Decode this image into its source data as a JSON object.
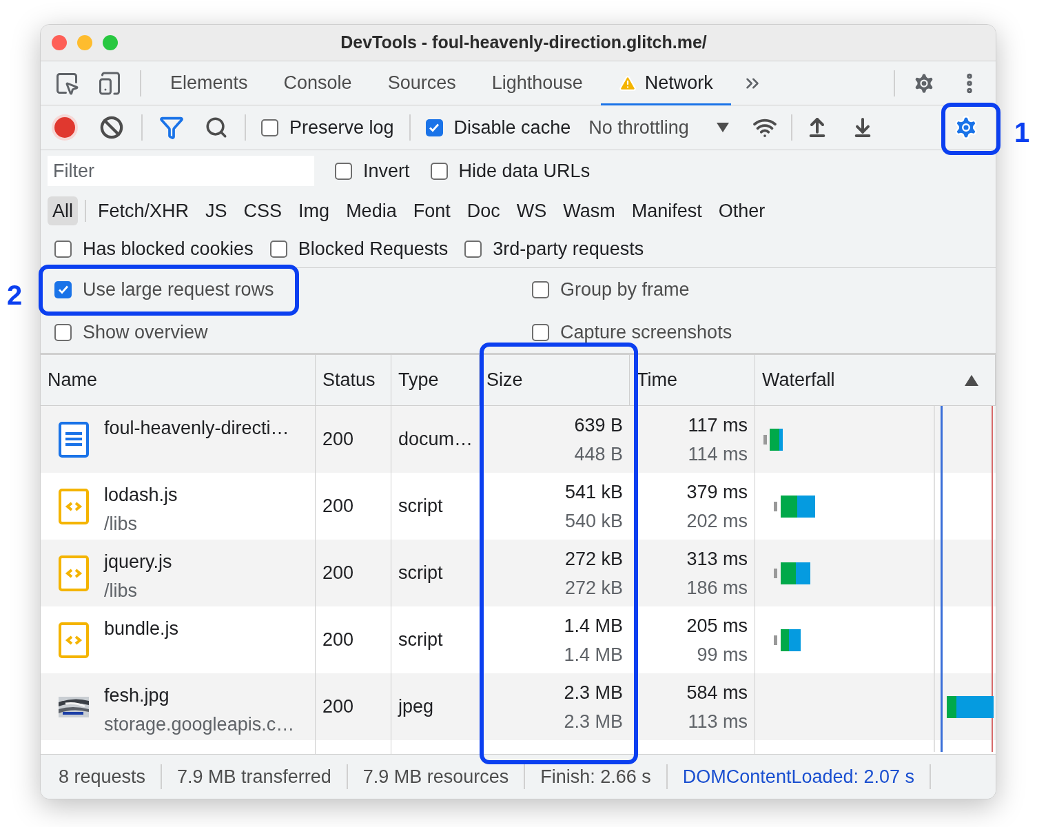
{
  "window": {
    "title": "DevTools - foul-heavenly-direction.glitch.me/"
  },
  "tabs": [
    {
      "label": "Elements",
      "kind": "plain",
      "selected": false
    },
    {
      "label": "Console",
      "kind": "plain",
      "selected": false
    },
    {
      "label": "Sources",
      "kind": "plain",
      "selected": false
    },
    {
      "label": "Lighthouse",
      "kind": "plain",
      "selected": false
    },
    {
      "label": "Network",
      "kind": "warning",
      "selected": true
    }
  ],
  "toolbar": {
    "preserve_log": {
      "label": "Preserve log",
      "checked": false
    },
    "disable_cache": {
      "label": "Disable cache",
      "checked": true
    },
    "throttling": {
      "value": "No throttling"
    }
  },
  "filter": {
    "placeholder": "Filter",
    "options": [
      {
        "label": "Invert",
        "checked": false
      },
      {
        "label": "Hide data URLs",
        "checked": false
      }
    ]
  },
  "type_filters": [
    {
      "label": "All",
      "selected": true
    },
    {
      "label": "Fetch/XHR",
      "selected": false
    },
    {
      "label": "JS",
      "selected": false
    },
    {
      "label": "CSS",
      "selected": false
    },
    {
      "label": "Img",
      "selected": false
    },
    {
      "label": "Media",
      "selected": false
    },
    {
      "label": "Font",
      "selected": false
    },
    {
      "label": "Doc",
      "selected": false
    },
    {
      "label": "WS",
      "selected": false
    },
    {
      "label": "Wasm",
      "selected": false
    },
    {
      "label": "Manifest",
      "selected": false
    },
    {
      "label": "Other",
      "selected": false
    }
  ],
  "request_filters": [
    {
      "label": "Has blocked cookies",
      "checked": false
    },
    {
      "label": "Blocked Requests",
      "checked": false
    },
    {
      "label": "3rd-party requests",
      "checked": false
    }
  ],
  "settings": [
    {
      "label": "Use large request rows",
      "checked": true
    },
    {
      "label": "Group by frame",
      "checked": false
    },
    {
      "label": "Show overview",
      "checked": false
    },
    {
      "label": "Capture screenshots",
      "checked": false
    }
  ],
  "table": {
    "columns": [
      {
        "label": "Name",
        "sorted": false
      },
      {
        "label": "Status",
        "sorted": false
      },
      {
        "label": "Type",
        "sorted": false
      },
      {
        "label": "Size",
        "sorted": false
      },
      {
        "label": "Time",
        "sorted": false
      },
      {
        "label": "Waterfall",
        "sorted": true
      }
    ],
    "rows": [
      {
        "kind": "document",
        "name": "foul-heavenly-directi…",
        "status": "200",
        "type": "docum…",
        "size": "639 B",
        "resource_size": "448 B",
        "time": "117 ms",
        "latency": "114 ms"
      },
      {
        "kind": "script",
        "name": "lodash.js",
        "path": "/libs",
        "status": "200",
        "type": "script",
        "size": "541 kB",
        "resource_size": "540 kB",
        "time": "379 ms",
        "latency": "202 ms"
      },
      {
        "kind": "script",
        "name": "jquery.js",
        "path": "/libs",
        "status": "200",
        "type": "script",
        "size": "272 kB",
        "resource_size": "272 kB",
        "time": "313 ms",
        "latency": "186 ms"
      },
      {
        "kind": "script",
        "name": "bundle.js",
        "status": "200",
        "type": "script",
        "size": "1.4 MB",
        "resource_size": "1.4 MB",
        "time": "205 ms",
        "latency": "99 ms"
      },
      {
        "name": "fesh.jpg",
        "path": "storage.googleapis.c…",
        "status": "200",
        "type": "jpeg",
        "size": "2.3 MB",
        "resource_size": "2.3 MB",
        "time": "584 ms",
        "latency": "113 ms"
      }
    ]
  },
  "status_bar": [
    {
      "text": "8 requests",
      "color": "#4d4d4d"
    },
    {
      "text": "7.9 MB transferred",
      "color": "#4d4d4d"
    },
    {
      "text": "7.9 MB resources",
      "color": "#4d4d4d"
    },
    {
      "text": "Finish: 2.66 s",
      "color": "#4d4d4d"
    },
    {
      "text": "DOMContentLoaded: 2.07 s",
      "color": "#1a4fd0"
    }
  ],
  "annotations": [
    {
      "label": "1"
    },
    {
      "label": "2"
    }
  ]
}
